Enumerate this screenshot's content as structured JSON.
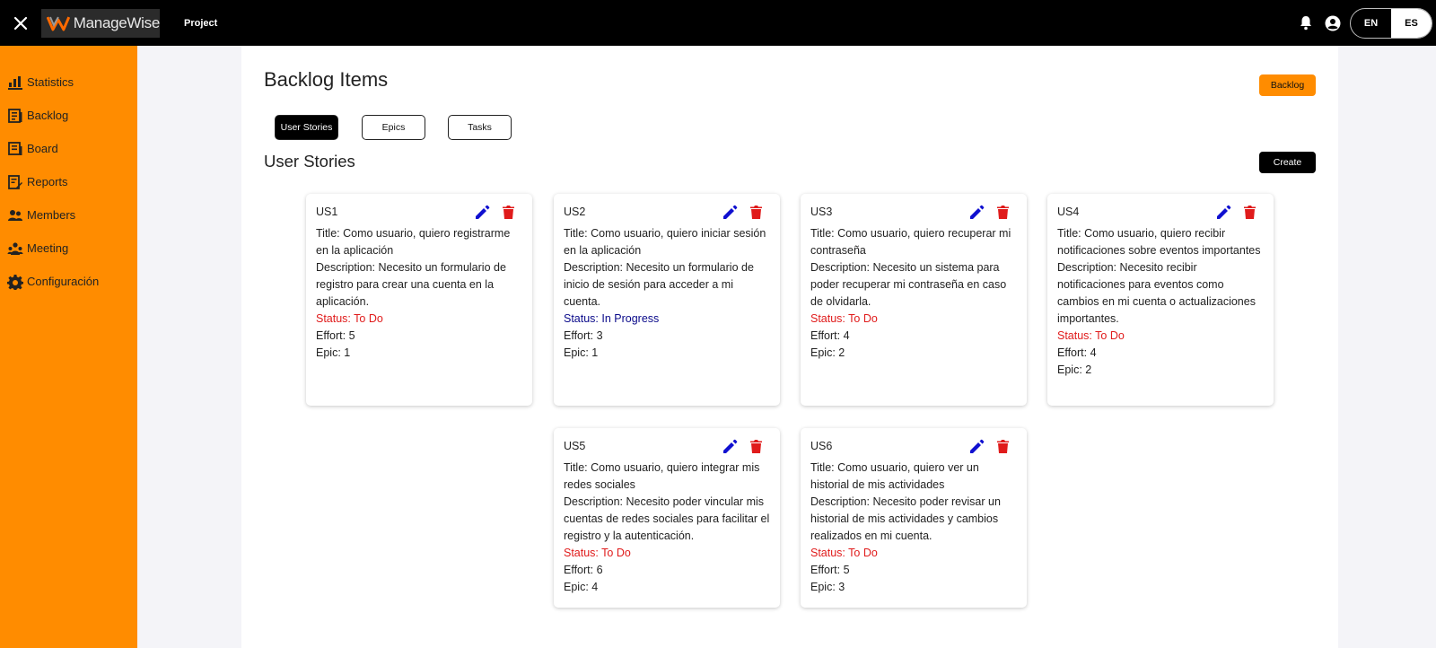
{
  "header": {
    "brand": "ManageWise",
    "nav_project": "Project",
    "languages": [
      {
        "code": "EN",
        "active": false
      },
      {
        "code": "ES",
        "active": true
      }
    ]
  },
  "sidebar": {
    "items": [
      {
        "label": "Statistics",
        "icon": "bar-chart-icon"
      },
      {
        "label": "Backlog",
        "icon": "backlog-icon"
      },
      {
        "label": "Board",
        "icon": "board-icon"
      },
      {
        "label": "Reports",
        "icon": "reports-icon"
      },
      {
        "label": "Members",
        "icon": "members-icon"
      },
      {
        "label": "Meeting",
        "icon": "meeting-icon"
      },
      {
        "label": "Configuración",
        "icon": "gear-icon"
      }
    ]
  },
  "main": {
    "title": "Backlog Items",
    "backlog_button": "Backlog",
    "tabs": [
      {
        "label": "User Stories",
        "active": true
      },
      {
        "label": "Epics",
        "active": false
      },
      {
        "label": "Tasks",
        "active": false
      }
    ],
    "section_title": "User Stories",
    "create_button": "Create"
  },
  "colors": {
    "accent": "#ff8c00",
    "edit_icon": "#1010d0",
    "delete_icon": "#e01b1b",
    "status_todo": "#e01b1b",
    "status_in_progress": "#0a0a8a"
  },
  "stories": [
    {
      "id": "US1",
      "title": "Title: Como usuario, quiero registrarme en la aplicación",
      "description": "Description: Necesito un formulario de registro para crear una cuenta en la aplicación.",
      "status": "Status: To Do",
      "effort": "Effort: 5",
      "epic": "Epic: 1"
    },
    {
      "id": "US2",
      "title": "Title: Como usuario, quiero iniciar sesión en la aplicación",
      "description": "Description: Necesito un formulario de inicio de sesión para acceder a mi cuenta.",
      "status": "Status: In Progress",
      "effort": "Effort: 3",
      "epic": "Epic: 1"
    },
    {
      "id": "US3",
      "title": "Title: Como usuario, quiero recuperar mi contraseña",
      "description": "Description: Necesito un sistema para poder recuperar mi contraseña en caso de olvidarla.",
      "status": "Status: To Do",
      "effort": "Effort: 4",
      "epic": "Epic: 2"
    },
    {
      "id": "US4",
      "title": "Title: Como usuario, quiero recibir notificaciones sobre eventos importantes",
      "description": "Description: Necesito recibir notificaciones para eventos como cambios en mi cuenta o actualizaciones importantes.",
      "status": "Status: To Do",
      "effort": "Effort: 4",
      "epic": "Epic: 2"
    },
    {
      "id": "US5",
      "title": "Title: Como usuario, quiero integrar mis redes sociales",
      "description": "Description: Necesito poder vincular mis cuentas de redes sociales para facilitar el registro y la autenticación.",
      "status": "Status: To Do",
      "effort": "Effort: 6",
      "epic": "Epic: 4"
    },
    {
      "id": "US6",
      "title": "Title: Como usuario, quiero ver un historial de mis actividades",
      "description": "Description: Necesito poder revisar un historial de mis actividades y cambios realizados en mi cuenta.",
      "status": "Status: To Do",
      "effort": "Effort: 5",
      "epic": "Epic: 3"
    }
  ]
}
